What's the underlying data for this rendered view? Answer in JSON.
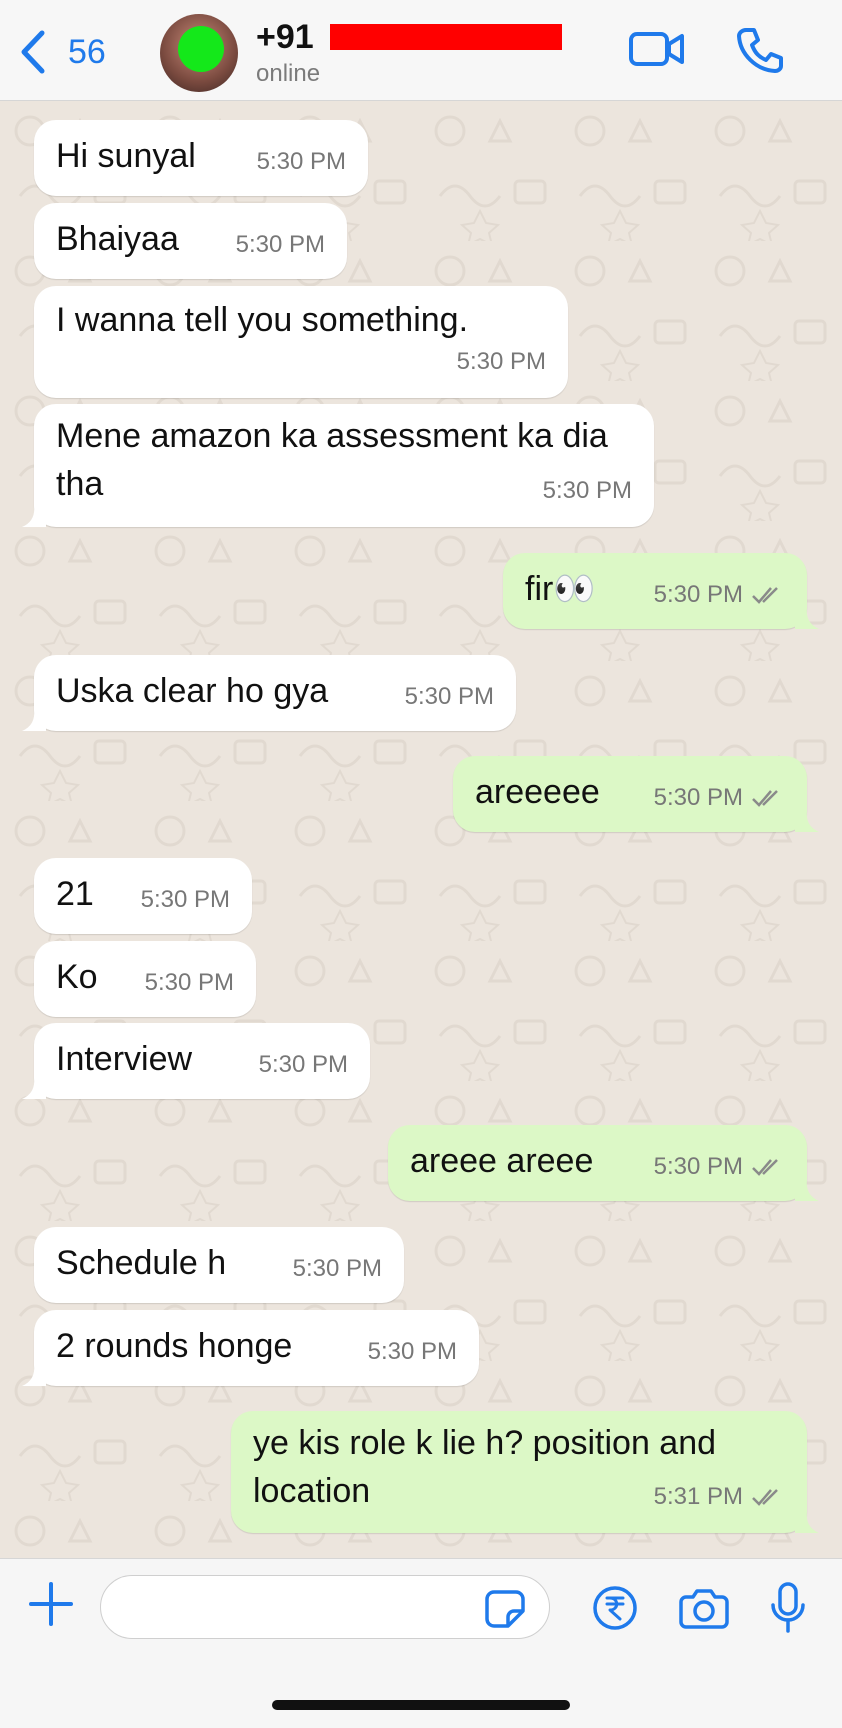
{
  "header": {
    "back_count": "56",
    "contact_prefix": "+91",
    "status": "online",
    "accent": "#1f7aeb"
  },
  "messages": [
    {
      "dir": "in",
      "text": "Hi sunyal",
      "time": "5:30 PM"
    },
    {
      "dir": "in",
      "text": "Bhaiyaa",
      "time": "5:30 PM"
    },
    {
      "dir": "in",
      "text": "I wanna tell you something.",
      "time": "5:30 PM"
    },
    {
      "dir": "in",
      "text": "Mene amazon ka assessment ka dia tha",
      "time": "5:30 PM"
    },
    {
      "dir": "out",
      "text": "fir👀",
      "time": "5:30 PM"
    },
    {
      "dir": "in",
      "text": "Uska clear ho gya",
      "time": "5:30 PM"
    },
    {
      "dir": "out",
      "text": "areeeee",
      "time": "5:30 PM"
    },
    {
      "dir": "in",
      "text": "21",
      "time": "5:30 PM"
    },
    {
      "dir": "in",
      "text": "Ko",
      "time": "5:30 PM"
    },
    {
      "dir": "in",
      "text": "Interview",
      "time": "5:30 PM"
    },
    {
      "dir": "out",
      "text": "areee areee",
      "time": "5:30 PM"
    },
    {
      "dir": "in",
      "text": "Schedule h",
      "time": "5:30 PM"
    },
    {
      "dir": "in",
      "text": "2 rounds honge",
      "time": "5:30 PM"
    },
    {
      "dir": "out",
      "text": "ye kis role k lie h? position and location",
      "time": "5:31 PM"
    }
  ],
  "colors": {
    "incoming_bubble": "#ffffff",
    "outgoing_bubble": "#dcf8c6",
    "chat_background": "#ece5dd",
    "redaction": "#ff0000",
    "avatar_overlay": "#14e81a"
  },
  "input_bar": {
    "icons": [
      "plus-icon",
      "sticker-icon",
      "rupee-icon",
      "camera-icon",
      "microphone-icon"
    ]
  }
}
